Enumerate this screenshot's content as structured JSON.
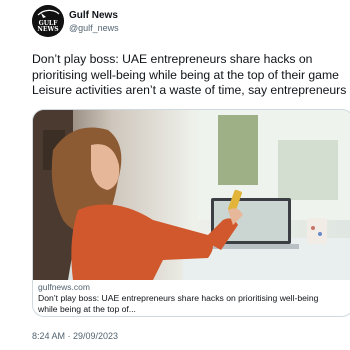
{
  "author": {
    "name": "Gulf News",
    "handle": "@gulf_news",
    "avatar_text_top": "GULF",
    "avatar_text_bottom": "NEWS"
  },
  "tweet": {
    "text_lines": [
      "Don’t play boss: UAE entrepreneurs share hacks on",
      "prioritising well-being while being at the top of their game",
      "Leisure activities aren’t a waste of time, say entrepreneurs"
    ],
    "timestamp": "8:24 AM · 29/09/2023"
  },
  "card": {
    "image_icon": "photo-woman-laptop",
    "domain": "gulfnews.com",
    "title_lines": [
      "Don’t play boss: UAE entrepreneurs share hacks on prioritising well-being",
      "while being at the top of..."
    ]
  },
  "colors": {
    "text": "#0f1419",
    "secondary": "#536471",
    "border": "#cfd9de"
  }
}
